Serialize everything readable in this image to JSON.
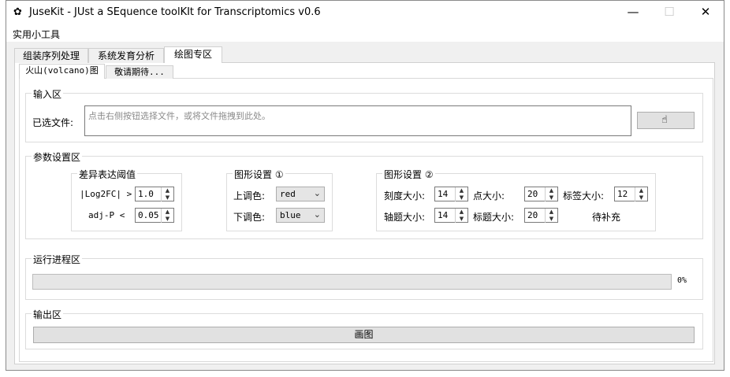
{
  "window": {
    "title": "JuseKit - JUst a SEquence toolKIt for Transcriptomics v0.6",
    "minimize": "—",
    "maximize": "☐",
    "close": "✕"
  },
  "menu": {
    "tools": "实用小工具"
  },
  "tabs": [
    "组装序列处理",
    "系统发育分析",
    "绘图专区"
  ],
  "subtabs": [
    "火山(volcano)图",
    "敬请期待..."
  ],
  "input": {
    "group_label": "输入区",
    "file_label": "已选文件:",
    "placeholder": "点击右侧按钮选择文件，或将文件拖拽到此处。",
    "button_icon": "hand-pointer-icon"
  },
  "params": {
    "group_label": "参数设置区",
    "de_threshold": {
      "label": "差异表达阈值",
      "log2fc_label": "|Log2FC| >",
      "log2fc_value": "1.0",
      "adjp_label": "adj-P <",
      "adjp_value": "0.05"
    },
    "graph1": {
      "label": "图形设置 ①",
      "up_label": "上调色:",
      "up_value": "red",
      "down_label": "下调色:",
      "down_value": "blue"
    },
    "graph2": {
      "label": "图形设置 ②",
      "tick_label": "刻度大小:",
      "tick_value": "14",
      "point_label": "点大小:",
      "point_value": "20",
      "tag_label": "标签大小:",
      "tag_value": "12",
      "axis_label": "轴题大小:",
      "axis_value": "14",
      "title_label": "标题大小:",
      "title_value": "20",
      "pending": "待补充"
    }
  },
  "progress": {
    "group_label": "运行进程区",
    "percent_text": "0%",
    "fraction": 0
  },
  "output": {
    "group_label": "输出区",
    "draw_button": "画图"
  }
}
